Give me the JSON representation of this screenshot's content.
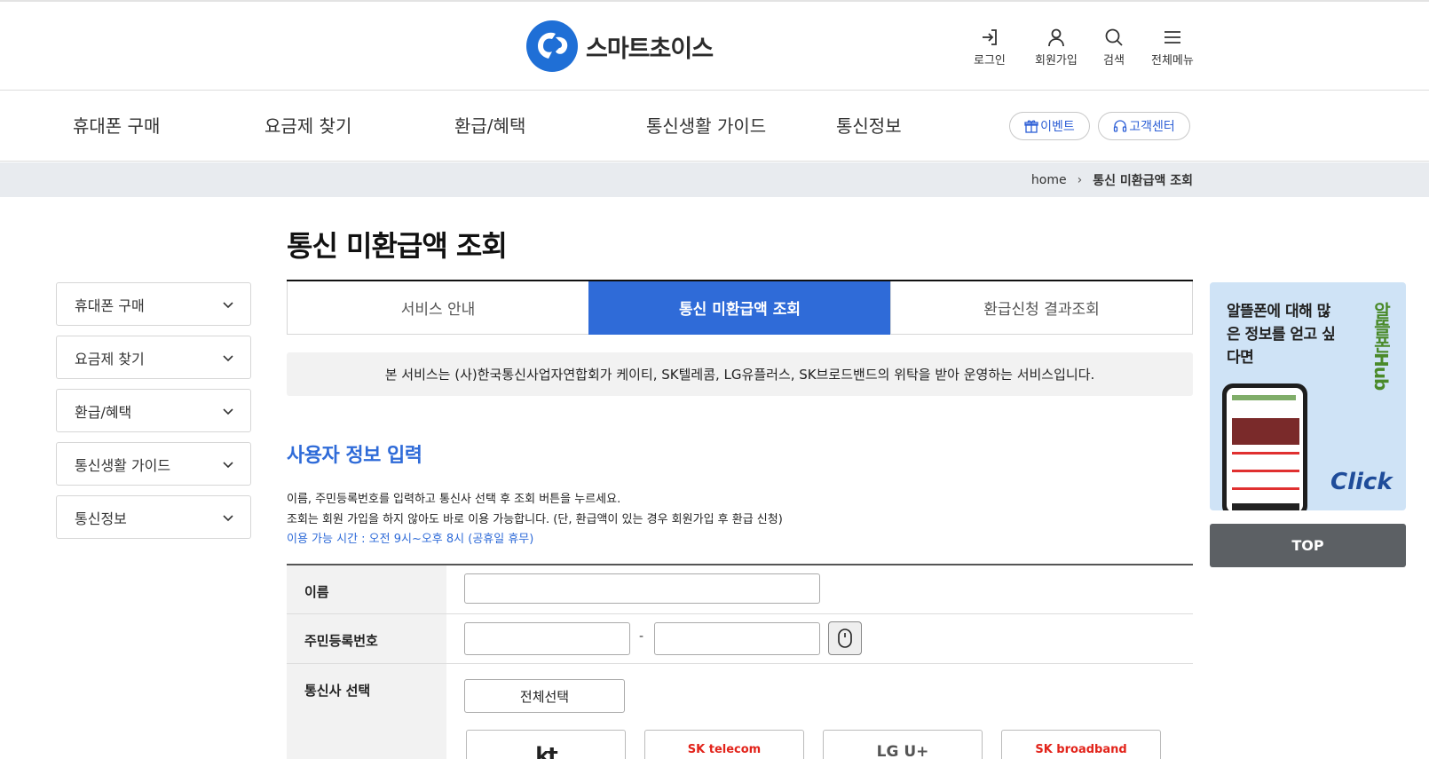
{
  "header": {
    "logo_text": "스마트초이스",
    "util": [
      {
        "label": "로그인",
        "icon": "login-icon"
      },
      {
        "label": "회원가입",
        "icon": "user-icon"
      },
      {
        "label": "검색",
        "icon": "search-icon"
      },
      {
        "label": "전체메뉴",
        "icon": "menu-icon"
      }
    ]
  },
  "gnb": {
    "items": [
      "휴대폰 구매",
      "요금제 찾기",
      "환급/혜택",
      "통신생활 가이드",
      "통신정보"
    ],
    "event_label": "이벤트",
    "support_label": "고객센터"
  },
  "breadcrumb": {
    "home": "home",
    "current": "통신 미환급액 조회"
  },
  "sidebar": {
    "items": [
      {
        "label": "휴대폰 구매"
      },
      {
        "label": "요금제 찾기"
      },
      {
        "label": "환급/혜택"
      },
      {
        "label": "통신생활 가이드"
      },
      {
        "label": "통신정보"
      }
    ]
  },
  "main": {
    "title": "통신 미환급액 조회",
    "tabs": [
      {
        "label": "서비스 안내"
      },
      {
        "label": "통신 미환급액 조회"
      },
      {
        "label": "환급신청 결과조회"
      }
    ],
    "notice": "본 서비스는 (사)한국통신사업자연합회가 케이티, SK텔레콤, LG유플러스, SK브로드밴드의 위탁을 받아 운영하는 서비스입니다.",
    "section_title": "사용자 정보 입력",
    "desc_1": "이름, 주민등록번호를 입력하고 통신사 선택 후 조회 버튼을 누르세요.",
    "desc_2": "조회는 회원 가입을 하지 않아도 바로 이용 가능합니다. (단, 환급액이 있는 경우 회원가입 후 환급 신청)",
    "desc_3": "이용 가능 시간 : 오전 9시~오후 8시 (공휴일 휴무)"
  },
  "form": {
    "name_label": "이름",
    "rrn_label": "주민등록번호",
    "rrn_dash": "-",
    "carrier_label": "통신사 선택",
    "select_all": "전체선택",
    "carriers": [
      "kt",
      "SK telecom",
      "LG U+",
      "SK broadband"
    ]
  },
  "banner": {
    "text": "알뜰폰에 대해 많은 정보를 얻고 싶다면",
    "brand": "알뜰폰Hub",
    "click": "Click"
  },
  "top_button": "TOP",
  "colors": {
    "accent": "#2f6bd8",
    "top_button": "#5c6064",
    "breadcrumb_bg": "#e8ebef",
    "banner_bg": "#cfe3f6"
  }
}
